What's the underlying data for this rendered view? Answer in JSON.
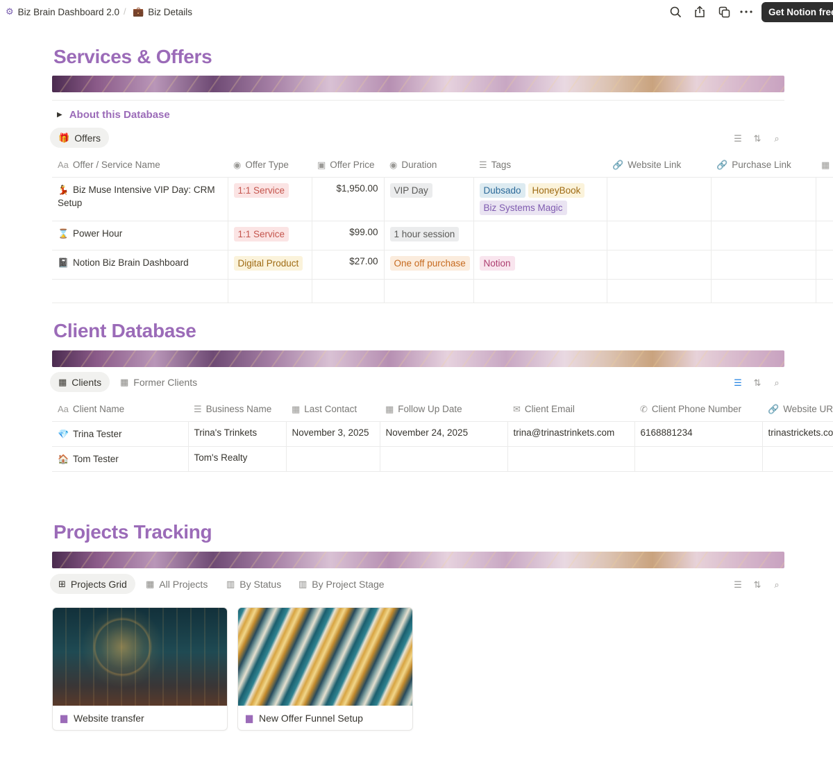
{
  "breadcrumb": {
    "workspace": "Biz Brain Dashboard 2.0",
    "separator": "/",
    "page": "Biz Details"
  },
  "topbar": {
    "icons": [
      "search-icon",
      "share-icon",
      "duplicate-icon",
      "more-icon"
    ],
    "cta_label": "Get Notion free"
  },
  "services": {
    "title": "Services & Offers",
    "toggle_label": "About this Database",
    "view_tab": "Offers",
    "columns": [
      "Offer / Service Name",
      "Offer Type",
      "Offer Price",
      "Duration",
      "Tags",
      "Website Link",
      "Purchase Link"
    ],
    "rows": [
      {
        "icon": "dancer-icon",
        "name": "Biz Muse Intensive VIP Day: CRM Setup",
        "type": "1:1 Service",
        "price": "$1,950.00",
        "duration": "VIP Day",
        "tags": [
          "Dubsado",
          "HoneyBook",
          "Biz Systems Magic"
        ]
      },
      {
        "icon": "hourglass-icon",
        "name": "Power Hour",
        "type": "1:1 Service",
        "price": "$99.00",
        "duration": "1 hour session",
        "tags": []
      },
      {
        "icon": "notebook-icon",
        "name": "Notion Biz Brain Dashboard",
        "type": "Digital Product",
        "price": "$27.00",
        "duration": "One off purchase",
        "tags": [
          "Notion"
        ]
      }
    ]
  },
  "clients": {
    "title": "Client Database",
    "view_tabs": [
      "Clients",
      "Former Clients"
    ],
    "columns": [
      "Client Name",
      "Business Name",
      "Last Contact",
      "Follow Up Date",
      "Client Email",
      "Client Phone Number",
      "Website URL"
    ],
    "rows": [
      {
        "icon": "gem-icon",
        "name": "Trina Tester",
        "business": "Trina's Trinkets",
        "last_contact": "November 3, 2025",
        "follow_up": "November 24, 2025",
        "email": "trina@trinastrinkets.com",
        "phone": "6168881234",
        "website": "trinastrickets.co"
      },
      {
        "icon": "house-icon",
        "name": "Tom Tester",
        "business": "Tom's Realty",
        "last_contact": "",
        "follow_up": "",
        "email": "",
        "phone": "",
        "website": ""
      }
    ]
  },
  "projects": {
    "title": "Projects Tracking",
    "view_tabs": [
      "Projects Grid",
      "All Projects",
      "By Status",
      "By Project Stage"
    ],
    "cards": [
      {
        "title": "Website transfer"
      },
      {
        "title": "New Offer Funnel Setup"
      }
    ]
  },
  "colors": {
    "heading": "#9b6bb8",
    "cta_bg": "#2f2f2f",
    "filter_active": "#2383e2"
  }
}
